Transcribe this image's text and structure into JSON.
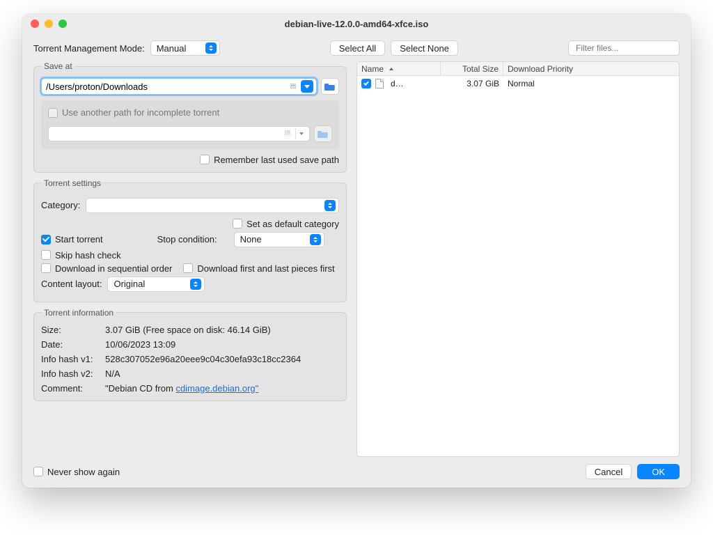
{
  "window": {
    "title": "debian-live-12.0.0-amd64-xfce.iso"
  },
  "top": {
    "mode_label": "Torrent Management Mode:",
    "mode_value": "Manual",
    "select_all": "Select All",
    "select_none": "Select None",
    "filter_placeholder": "Filter files..."
  },
  "save_at": {
    "legend": "Save at",
    "path": "/Users/proton/Downloads",
    "use_another_label": "Use another path for incomplete torrent",
    "use_another_checked": false,
    "remember_label": "Remember last used save path",
    "remember_checked": false
  },
  "settings": {
    "legend": "Torrent settings",
    "category_label": "Category:",
    "category_value": "",
    "default_cat_label": "Set as default category",
    "default_cat_checked": false,
    "start_torrent_label": "Start torrent",
    "start_torrent_checked": true,
    "stop_cond_label": "Stop condition:",
    "stop_cond_value": "None",
    "skip_hash_label": "Skip hash check",
    "skip_hash_checked": false,
    "sequential_label": "Download in sequential order",
    "sequential_checked": false,
    "firstlast_label": "Download first and last pieces first",
    "firstlast_checked": false,
    "content_layout_label": "Content layout:",
    "content_layout_value": "Original"
  },
  "info": {
    "legend": "Torrent information",
    "size_k": "Size:",
    "size_v": "3.07 GiB (Free space on disk: 46.14 GiB)",
    "date_k": "Date:",
    "date_v": "10/06/2023 13:09",
    "hash1_k": "Info hash v1:",
    "hash1_v": "528c307052e96a20eee9c04c30efa93c18cc2364",
    "hash2_k": "Info hash v2:",
    "hash2_v": "N/A",
    "comment_k": "Comment:",
    "comment_pre": "\"Debian CD from ",
    "comment_link": "cdimage.debian.org\"",
    "comment_post": ""
  },
  "files": {
    "cols": {
      "name": "Name",
      "size": "Total Size",
      "priority": "Download Priority"
    },
    "rows": [
      {
        "checked": true,
        "name": "d…",
        "size": "3.07 GiB",
        "priority": "Normal"
      }
    ]
  },
  "bottom": {
    "never_show_label": "Never show again",
    "never_show_checked": false,
    "cancel": "Cancel",
    "ok": "OK"
  }
}
